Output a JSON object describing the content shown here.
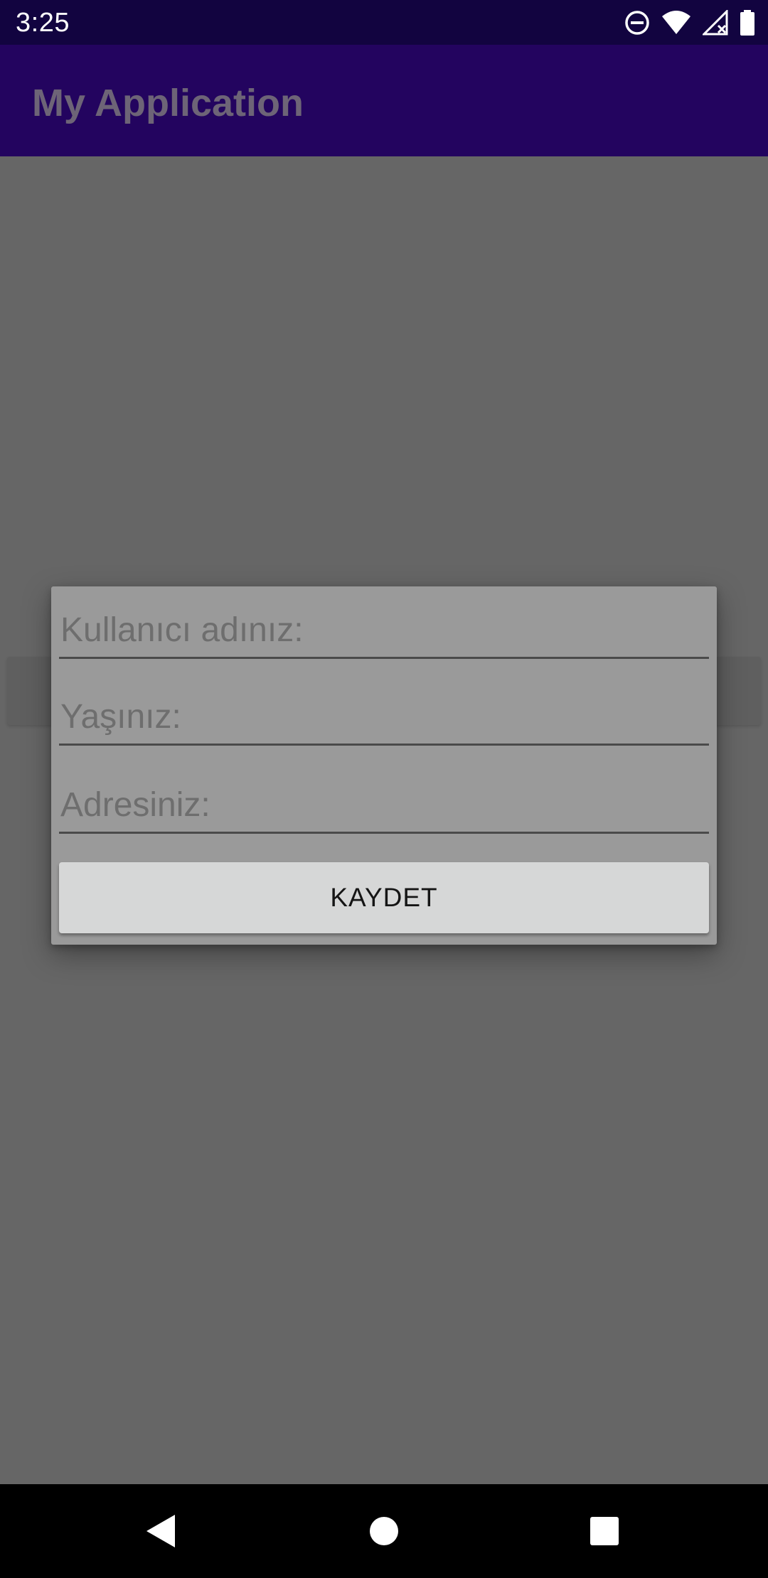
{
  "status_bar": {
    "time": "3:25",
    "icons": [
      "do-not-disturb-icon",
      "wifi-icon",
      "signal-no-service-icon",
      "battery-icon"
    ]
  },
  "app_bar": {
    "title": "My Application"
  },
  "dialog": {
    "fields": [
      {
        "placeholder": "Kullanıcı adınız:"
      },
      {
        "placeholder": "Yaşınız:"
      },
      {
        "placeholder": "Adresiniz:"
      }
    ],
    "save_label": "KAYDET"
  },
  "nav_bar": {
    "icons": [
      "back-icon",
      "home-icon",
      "recents-icon"
    ]
  },
  "colors": {
    "status_bar_bg": "#120440",
    "app_bar_bg": "#23045f",
    "scrim_bg": "#666666",
    "dialog_bg": "#9a9a9a",
    "button_bg": "#d6d7d7"
  }
}
